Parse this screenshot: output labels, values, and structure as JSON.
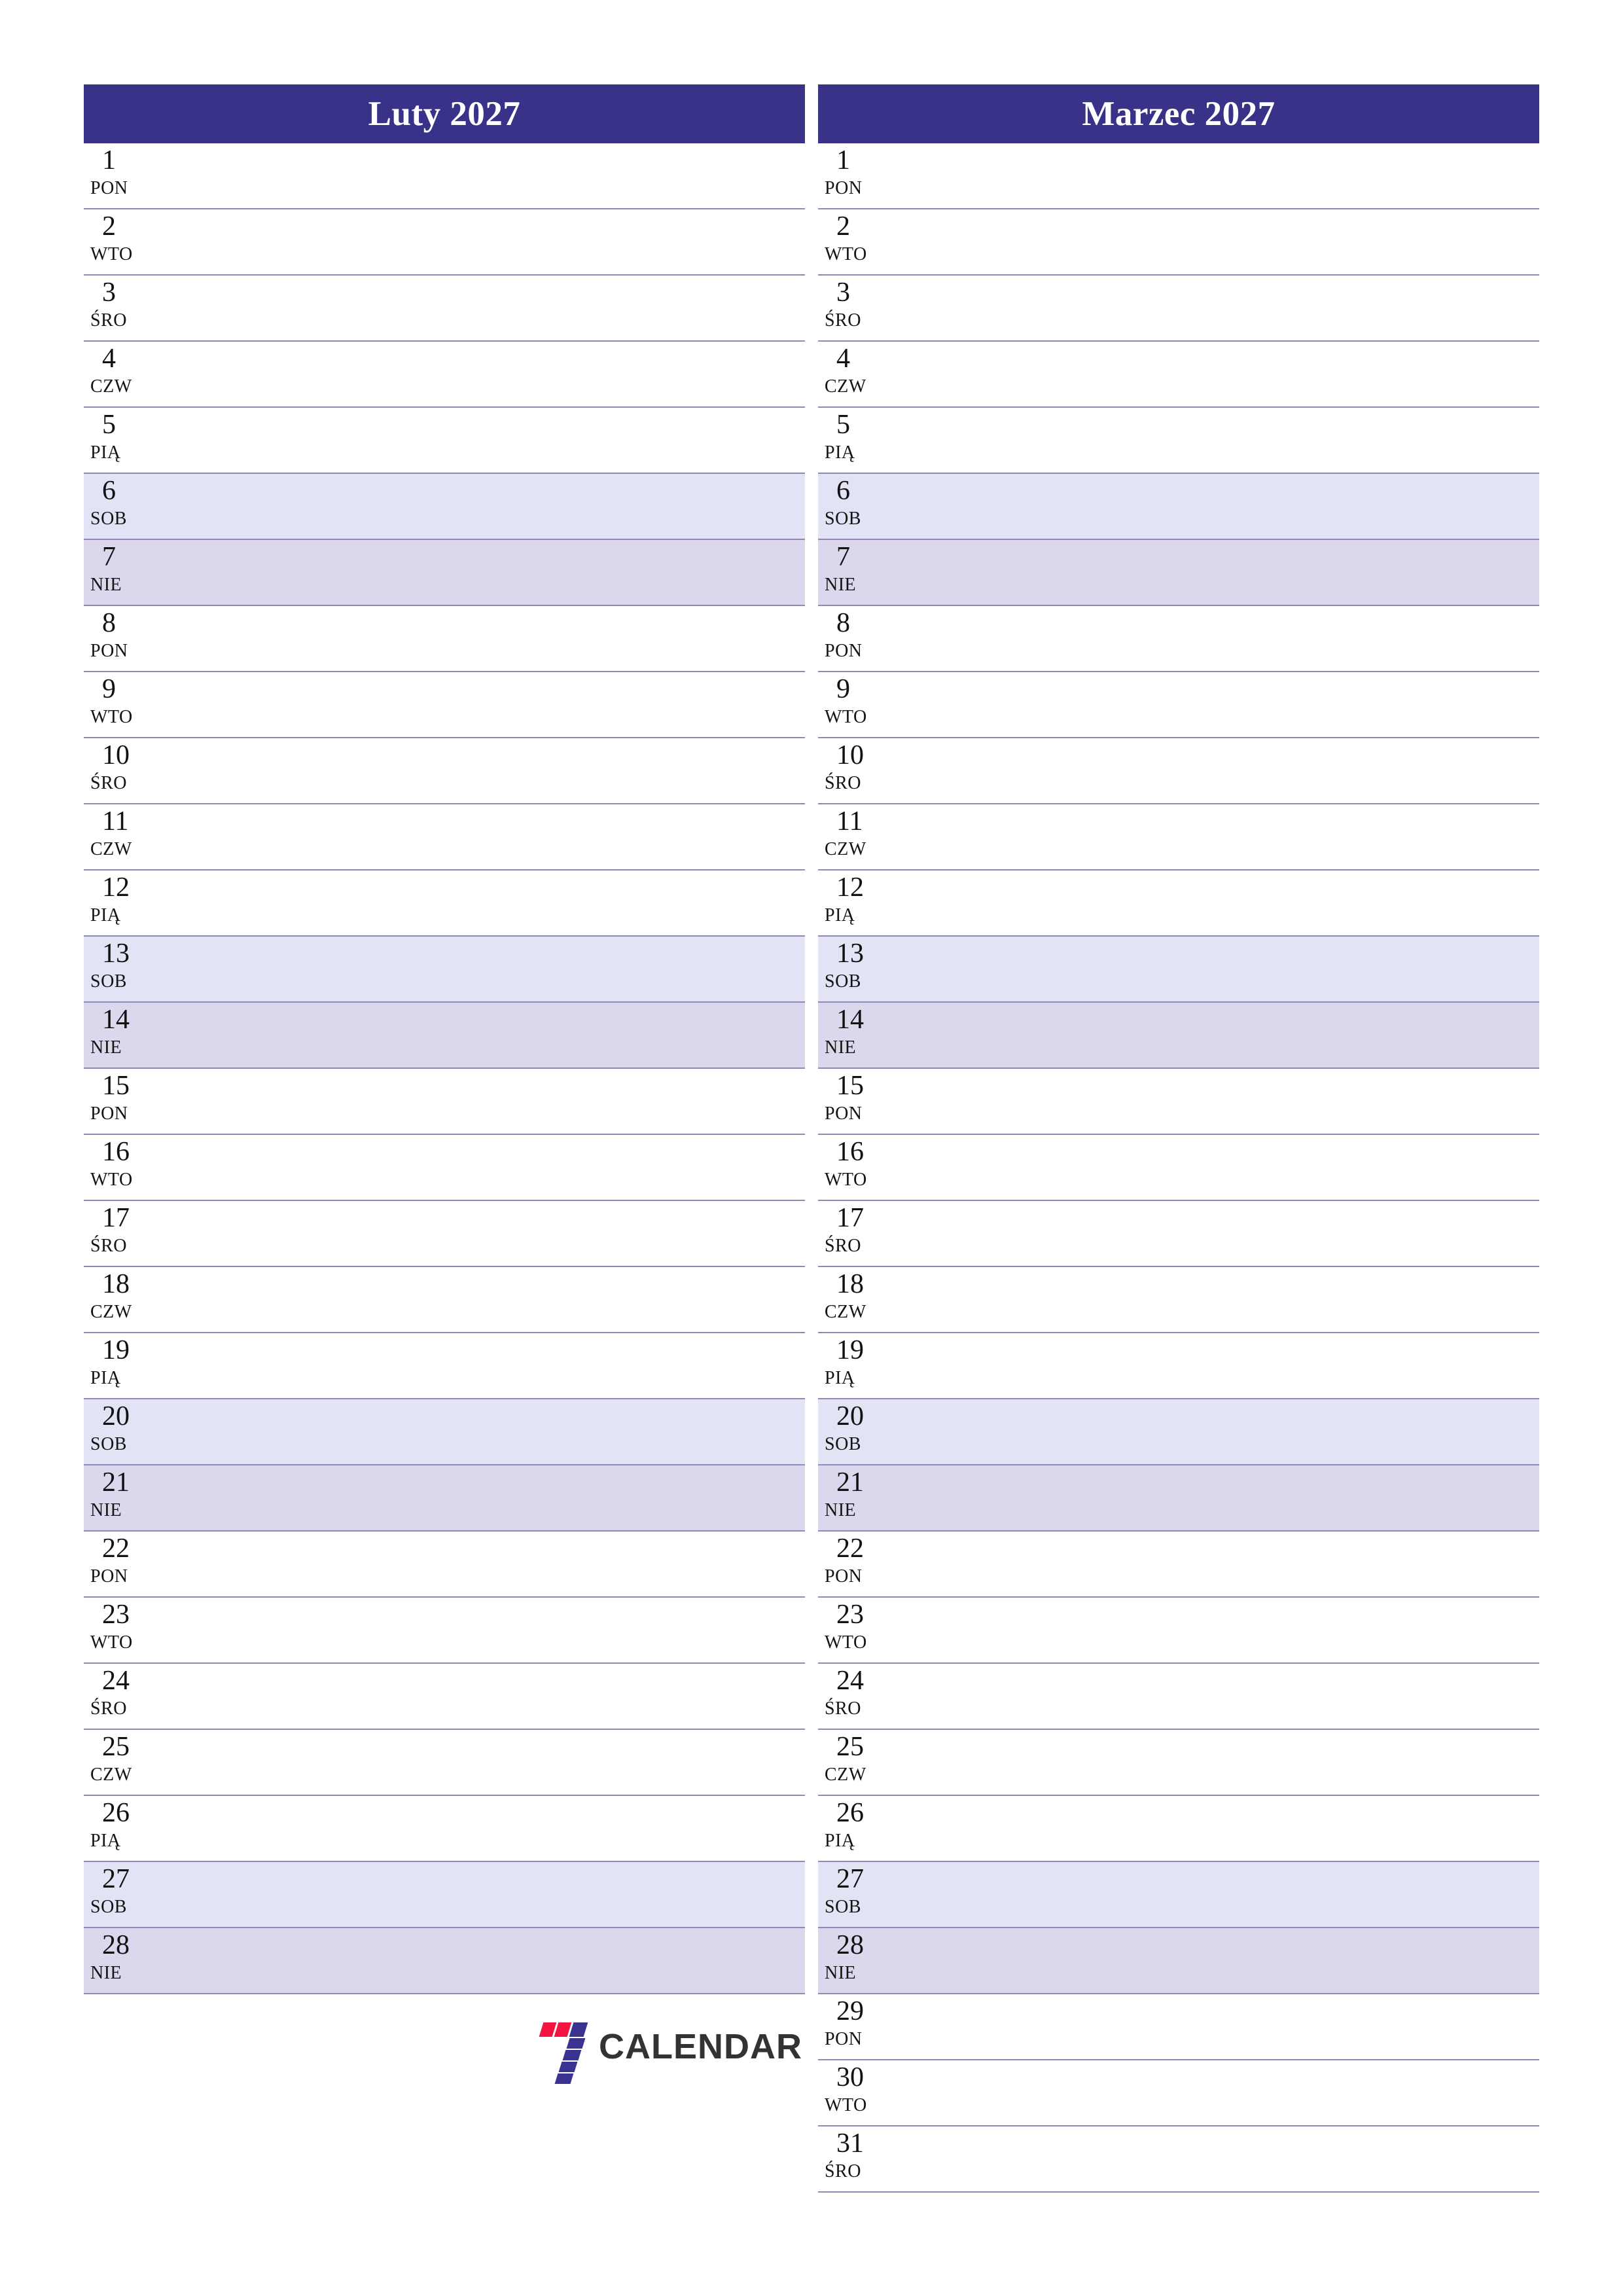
{
  "page": {
    "background_color": "#ffffff",
    "accent_color": "#383288",
    "saturday_color": "#e3e3f6",
    "sunday_color": "#dcd7ec",
    "separator_color": "#8d8bb5"
  },
  "brand": {
    "name": "CALENDAR",
    "mark": "seven-logo-icon",
    "mark_colors": [
      "#f5133f",
      "#3b3392"
    ]
  },
  "months": [
    {
      "title": "Luty 2027",
      "days": [
        {
          "num": "1",
          "abbr": "PON",
          "type": "weekday"
        },
        {
          "num": "2",
          "abbr": "WTO",
          "type": "weekday"
        },
        {
          "num": "3",
          "abbr": "ŚRO",
          "type": "weekday"
        },
        {
          "num": "4",
          "abbr": "CZW",
          "type": "weekday"
        },
        {
          "num": "5",
          "abbr": "PIĄ",
          "type": "weekday"
        },
        {
          "num": "6",
          "abbr": "SOB",
          "type": "saturday"
        },
        {
          "num": "7",
          "abbr": "NIE",
          "type": "sunday"
        },
        {
          "num": "8",
          "abbr": "PON",
          "type": "weekday"
        },
        {
          "num": "9",
          "abbr": "WTO",
          "type": "weekday"
        },
        {
          "num": "10",
          "abbr": "ŚRO",
          "type": "weekday"
        },
        {
          "num": "11",
          "abbr": "CZW",
          "type": "weekday"
        },
        {
          "num": "12",
          "abbr": "PIĄ",
          "type": "weekday"
        },
        {
          "num": "13",
          "abbr": "SOB",
          "type": "saturday"
        },
        {
          "num": "14",
          "abbr": "NIE",
          "type": "sunday"
        },
        {
          "num": "15",
          "abbr": "PON",
          "type": "weekday"
        },
        {
          "num": "16",
          "abbr": "WTO",
          "type": "weekday"
        },
        {
          "num": "17",
          "abbr": "ŚRO",
          "type": "weekday"
        },
        {
          "num": "18",
          "abbr": "CZW",
          "type": "weekday"
        },
        {
          "num": "19",
          "abbr": "PIĄ",
          "type": "weekday"
        },
        {
          "num": "20",
          "abbr": "SOB",
          "type": "saturday"
        },
        {
          "num": "21",
          "abbr": "NIE",
          "type": "sunday"
        },
        {
          "num": "22",
          "abbr": "PON",
          "type": "weekday"
        },
        {
          "num": "23",
          "abbr": "WTO",
          "type": "weekday"
        },
        {
          "num": "24",
          "abbr": "ŚRO",
          "type": "weekday"
        },
        {
          "num": "25",
          "abbr": "CZW",
          "type": "weekday"
        },
        {
          "num": "26",
          "abbr": "PIĄ",
          "type": "weekday"
        },
        {
          "num": "27",
          "abbr": "SOB",
          "type": "saturday"
        },
        {
          "num": "28",
          "abbr": "NIE",
          "type": "sunday"
        }
      ]
    },
    {
      "title": "Marzec 2027",
      "days": [
        {
          "num": "1",
          "abbr": "PON",
          "type": "weekday"
        },
        {
          "num": "2",
          "abbr": "WTO",
          "type": "weekday"
        },
        {
          "num": "3",
          "abbr": "ŚRO",
          "type": "weekday"
        },
        {
          "num": "4",
          "abbr": "CZW",
          "type": "weekday"
        },
        {
          "num": "5",
          "abbr": "PIĄ",
          "type": "weekday"
        },
        {
          "num": "6",
          "abbr": "SOB",
          "type": "saturday"
        },
        {
          "num": "7",
          "abbr": "NIE",
          "type": "sunday"
        },
        {
          "num": "8",
          "abbr": "PON",
          "type": "weekday"
        },
        {
          "num": "9",
          "abbr": "WTO",
          "type": "weekday"
        },
        {
          "num": "10",
          "abbr": "ŚRO",
          "type": "weekday"
        },
        {
          "num": "11",
          "abbr": "CZW",
          "type": "weekday"
        },
        {
          "num": "12",
          "abbr": "PIĄ",
          "type": "weekday"
        },
        {
          "num": "13",
          "abbr": "SOB",
          "type": "saturday"
        },
        {
          "num": "14",
          "abbr": "NIE",
          "type": "sunday"
        },
        {
          "num": "15",
          "abbr": "PON",
          "type": "weekday"
        },
        {
          "num": "16",
          "abbr": "WTO",
          "type": "weekday"
        },
        {
          "num": "17",
          "abbr": "ŚRO",
          "type": "weekday"
        },
        {
          "num": "18",
          "abbr": "CZW",
          "type": "weekday"
        },
        {
          "num": "19",
          "abbr": "PIĄ",
          "type": "weekday"
        },
        {
          "num": "20",
          "abbr": "SOB",
          "type": "saturday"
        },
        {
          "num": "21",
          "abbr": "NIE",
          "type": "sunday"
        },
        {
          "num": "22",
          "abbr": "PON",
          "type": "weekday"
        },
        {
          "num": "23",
          "abbr": "WTO",
          "type": "weekday"
        },
        {
          "num": "24",
          "abbr": "ŚRO",
          "type": "weekday"
        },
        {
          "num": "25",
          "abbr": "CZW",
          "type": "weekday"
        },
        {
          "num": "26",
          "abbr": "PIĄ",
          "type": "weekday"
        },
        {
          "num": "27",
          "abbr": "SOB",
          "type": "saturday"
        },
        {
          "num": "28",
          "abbr": "NIE",
          "type": "sunday"
        },
        {
          "num": "29",
          "abbr": "PON",
          "type": "weekday"
        },
        {
          "num": "30",
          "abbr": "WTO",
          "type": "weekday"
        },
        {
          "num": "31",
          "abbr": "ŚRO",
          "type": "weekday"
        }
      ]
    }
  ]
}
